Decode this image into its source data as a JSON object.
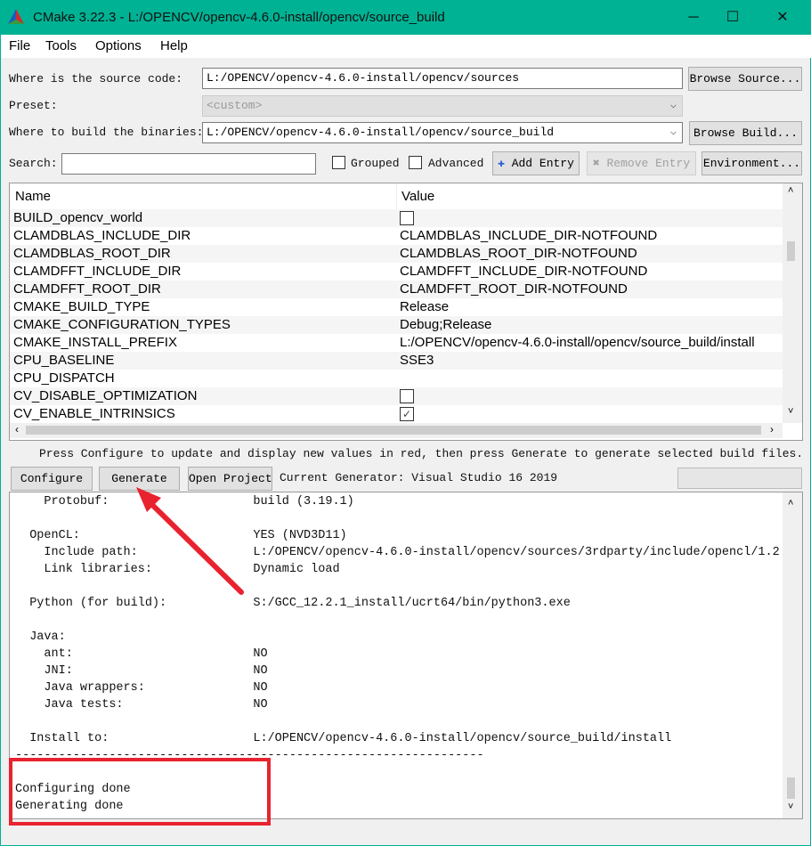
{
  "window": {
    "title": "CMake 3.22.3 - L:/OPENCV/opencv-4.6.0-install/opencv/source_build",
    "minimize": "─",
    "maximize": "☐",
    "close": "✕"
  },
  "menu": [
    "File",
    "Tools",
    "Options",
    "Help"
  ],
  "source": {
    "label": "Where is the source code:",
    "value": "L:/OPENCV/opencv-4.6.0-install/opencv/sources",
    "button": "Browse Source..."
  },
  "preset": {
    "label": "Preset:",
    "value": "<custom>"
  },
  "build": {
    "label": "Where to build the binaries:",
    "value": "L:/OPENCV/opencv-4.6.0-install/opencv/source_build",
    "button": "Browse Build..."
  },
  "search": {
    "label": "Search:",
    "value": ""
  },
  "options": {
    "grouped": "Grouped",
    "advanced": "Advanced",
    "grouped_checked": false,
    "advanced_checked": false
  },
  "buttons": {
    "add_entry": "Add Entry",
    "remove_entry": "Remove Entry",
    "environment": "Environment...",
    "configure": "Configure",
    "generate": "Generate",
    "open_project": "Open Project"
  },
  "table": {
    "headers": [
      "Name",
      "Value"
    ],
    "rows": [
      {
        "name": "BUILD_opencv_world",
        "type": "bool",
        "checked": false
      },
      {
        "name": "CLAMDBLAS_INCLUDE_DIR",
        "value": "CLAMDBLAS_INCLUDE_DIR-NOTFOUND"
      },
      {
        "name": "CLAMDBLAS_ROOT_DIR",
        "value": "CLAMDBLAS_ROOT_DIR-NOTFOUND"
      },
      {
        "name": "CLAMDFFT_INCLUDE_DIR",
        "value": "CLAMDFFT_INCLUDE_DIR-NOTFOUND"
      },
      {
        "name": "CLAMDFFT_ROOT_DIR",
        "value": "CLAMDFFT_ROOT_DIR-NOTFOUND"
      },
      {
        "name": "CMAKE_BUILD_TYPE",
        "value": "Release"
      },
      {
        "name": "CMAKE_CONFIGURATION_TYPES",
        "value": "Debug;Release"
      },
      {
        "name": "CMAKE_INSTALL_PREFIX",
        "value": "L:/OPENCV/opencv-4.6.0-install/opencv/source_build/install"
      },
      {
        "name": "CPU_BASELINE",
        "value": "SSE3"
      },
      {
        "name": "CPU_DISPATCH",
        "value": ""
      },
      {
        "name": "CV_DISABLE_OPTIMIZATION",
        "type": "bool",
        "checked": false
      },
      {
        "name": "CV_ENABLE_INTRINSICS",
        "type": "bool",
        "checked": true
      }
    ]
  },
  "hint": "Press Configure to update and display new values in red, then press Generate to generate selected build files.",
  "generator": "Current Generator: Visual Studio 16 2019",
  "log": "    Protobuf:                    build (3.19.1)\n\n  OpenCL:                        YES (NVD3D11)\n    Include path:                L:/OPENCV/opencv-4.6.0-install/opencv/sources/3rdparty/include/opencl/1.2\n    Link libraries:              Dynamic load\n\n  Python (for build):            S:/GCC_12.2.1_install/ucrt64/bin/python3.exe\n\n  Java:\n    ant:                         NO\n    JNI:                         NO\n    Java wrappers:               NO\n    Java tests:                  NO\n\n  Install to:                    L:/OPENCV/opencv-4.6.0-install/opencv/source_build/install\n-----------------------------------------------------------------\n\nConfiguring done\nGenerating done",
  "annotation_color": "#e8232f"
}
